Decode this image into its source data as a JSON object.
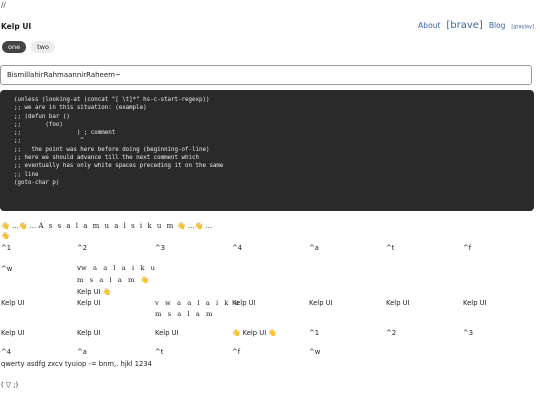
{
  "header": {
    "slash": "//",
    "brand": "Kelp UI",
    "nav": [
      "About",
      "[brave]",
      "Blog",
      "[grayjay]"
    ]
  },
  "pills": [
    "one",
    "two"
  ],
  "search": {
    "value": "BismillahirRahmaannirRaheem~"
  },
  "code_lines": [
    "(unless (looking-at (concat \"[ \\t]*\" hs-c-start-regexp))",
    ";; we are in this situation: (example)",
    ";; (defun bar ()",
    ";;       (foo)",
    ";;                ) ; comment",
    ";;                 ^",
    ";;   the point was here before doing (beginning-of-line)",
    ";; here we should advance till the next comment which",
    ";; eventually has only white spaces preceding it on the same",
    ";; line",
    "(goto-char p)"
  ],
  "wave": {
    "prefix": "👋 ...👋 ... ",
    "text": "A s s a l a m u a l s i k u m",
    "suffix": " 👋 ...👋 ...",
    "next": "👋"
  },
  "grid": {
    "row1": [
      "^1",
      "^2",
      "^3",
      "^4",
      "^a",
      "^t",
      "^f"
    ],
    "row2a": "^w",
    "row2b_l1": "v",
    "row2b_l1s": "w a a l a i k u",
    "row2b_l2": "m s a l a m 👋",
    "row2b_l3": "Kelp UI 👋",
    "row3": [
      "Kelp UI",
      "Kelp UI",
      "Kelp UI",
      "Kelp UI",
      "Kelp UI",
      "Kelp UI"
    ],
    "row3_wave_l1": "v w a a l a i k u",
    "row3_wave_l2": "m s a l a m",
    "row4": [
      "Kelp UI",
      "Kelp UI",
      "Kelp UI",
      "👋 Kelp UI 👋",
      "^1",
      "^2",
      "^3"
    ],
    "row5": [
      "^4",
      "^a",
      "^t",
      "^f",
      "^w"
    ]
  },
  "qwerty": "qwerty asdfg zxcv tyuiop -= bnm,. hjkl 1234",
  "face": "(  ▽  ;)"
}
